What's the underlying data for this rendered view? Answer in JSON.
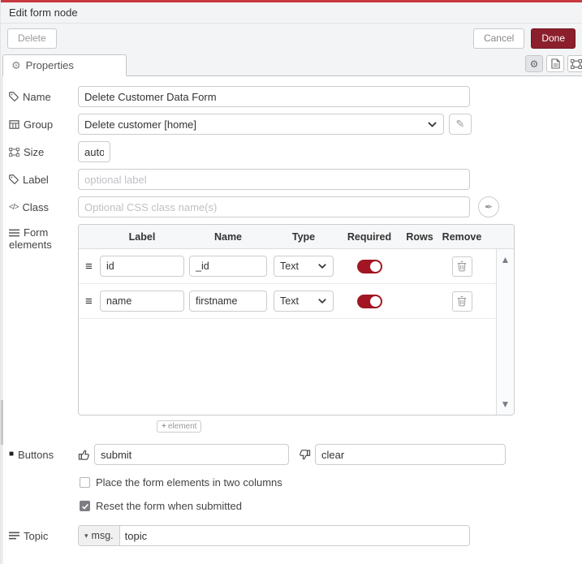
{
  "chrome": {
    "title": "Edit form node",
    "delete_label": "Delete",
    "cancel_label": "Cancel",
    "done_label": "Done",
    "tab_label": "Properties"
  },
  "colors": {
    "topbar_red": "#c7383f",
    "primary_button": "#8C1F2C",
    "toggle_on": "#A21522"
  },
  "icons": {
    "gear": "⚙",
    "caret_down": "▾",
    "scroll_up": "▲",
    "scroll_down": "▼",
    "drag_handle": "≡",
    "pencil": "✎",
    "pen_nib": "✒",
    "code": "</>",
    "square": "■",
    "plus": "+"
  },
  "fields": {
    "name": {
      "label": "Name",
      "value": "Delete Customer Data Form"
    },
    "group": {
      "label": "Group",
      "value": "Delete customer [home]"
    },
    "size": {
      "label": "Size",
      "value": "auto"
    },
    "label": {
      "label": "Label",
      "placeholder": "optional label"
    },
    "class": {
      "label": "Class",
      "placeholder": "Optional CSS class name(s)"
    },
    "form_elements": {
      "label": "Form elements"
    },
    "buttons": {
      "label": "Buttons",
      "submit_value": "submit",
      "clear_value": "clear"
    },
    "topic": {
      "label": "Topic",
      "prefix": "msg.",
      "value": "topic"
    }
  },
  "elements_table": {
    "headers": [
      "Label",
      "Name",
      "Type",
      "Required",
      "Rows",
      "Remove"
    ],
    "rows": [
      {
        "label": "id",
        "name": "_id",
        "type": "Text",
        "required": true
      },
      {
        "label": "name",
        "name": "firstname",
        "type": "Text",
        "required": true
      }
    ],
    "add_label": "element"
  },
  "options": {
    "two_columns": {
      "label": "Place the form elements in two columns",
      "checked": false
    },
    "reset": {
      "label": "Reset the form when submitted",
      "checked": true
    }
  }
}
